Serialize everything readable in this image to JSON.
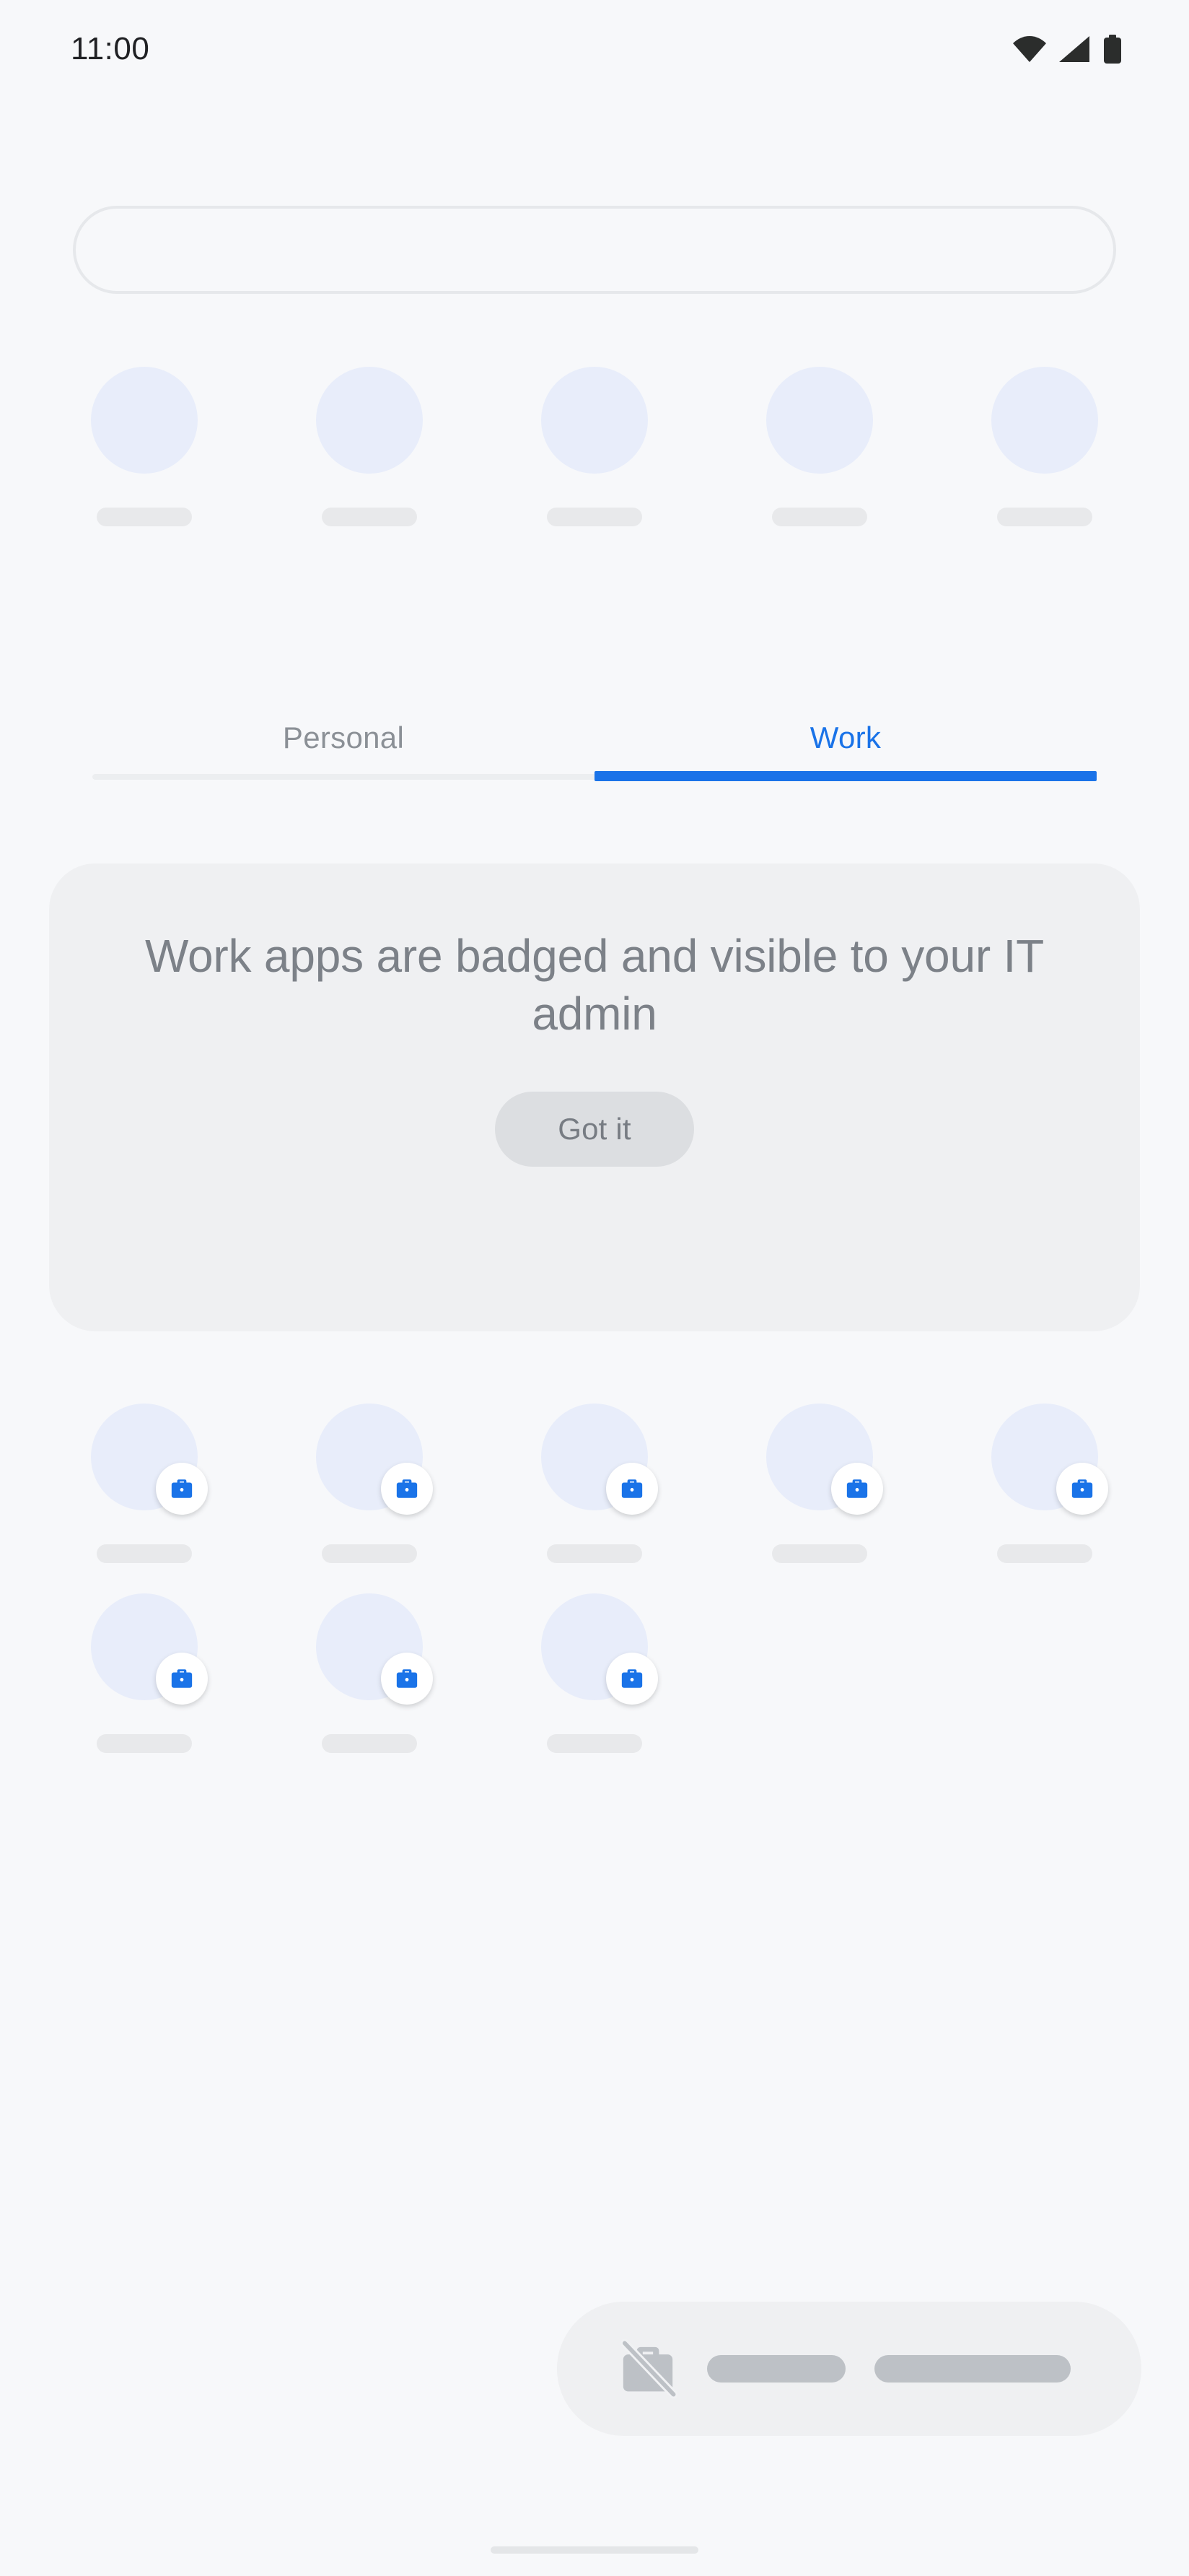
{
  "status_bar": {
    "time": "11:00",
    "icons": [
      "wifi-icon",
      "cell-signal-icon",
      "battery-icon"
    ]
  },
  "search": {
    "value": "",
    "placeholder": ""
  },
  "suggestions_row": {
    "loading": true,
    "items": [
      {
        "icon": "app-icon-placeholder",
        "label": ""
      },
      {
        "icon": "app-icon-placeholder",
        "label": ""
      },
      {
        "icon": "app-icon-placeholder",
        "label": ""
      },
      {
        "icon": "app-icon-placeholder",
        "label": ""
      },
      {
        "icon": "app-icon-placeholder",
        "label": ""
      }
    ]
  },
  "tabs": {
    "items": [
      {
        "label": "Personal",
        "active": false
      },
      {
        "label": "Work",
        "active": true
      }
    ],
    "active_index": 1
  },
  "info_card": {
    "title": "Work apps are badged and visible to your IT admin",
    "button_label": "Got it"
  },
  "work_apps": {
    "rows": [
      [
        {
          "badge": "work-briefcase-badge-icon",
          "label": ""
        },
        {
          "badge": "work-briefcase-badge-icon",
          "label": ""
        },
        {
          "badge": "work-briefcase-badge-icon",
          "label": ""
        },
        {
          "badge": "work-briefcase-badge-icon",
          "label": ""
        },
        {
          "badge": "work-briefcase-badge-icon",
          "label": ""
        }
      ],
      [
        {
          "badge": "work-briefcase-badge-icon",
          "label": ""
        },
        {
          "badge": "work-briefcase-badge-icon",
          "label": ""
        },
        {
          "badge": "work-briefcase-badge-icon",
          "label": ""
        }
      ]
    ]
  },
  "bottom_bar": {
    "icon": "work-profile-off-icon",
    "label_primary": "",
    "label_secondary": ""
  },
  "system_nav": {
    "home_indicator": "home-gesture-bar"
  },
  "colors": {
    "background": "#f7f8fa",
    "accent_blue": "#1a73e8",
    "badge_blue": "#1a73e8",
    "skeleton_icon": "#e8edfa",
    "skeleton_label": "#e8e9eb",
    "card_background": "#eff0f2",
    "card_text": "#7c8188",
    "button_background": "#dcdee1",
    "tab_inactive_text": "#8b9096",
    "status_text": "#202124"
  }
}
